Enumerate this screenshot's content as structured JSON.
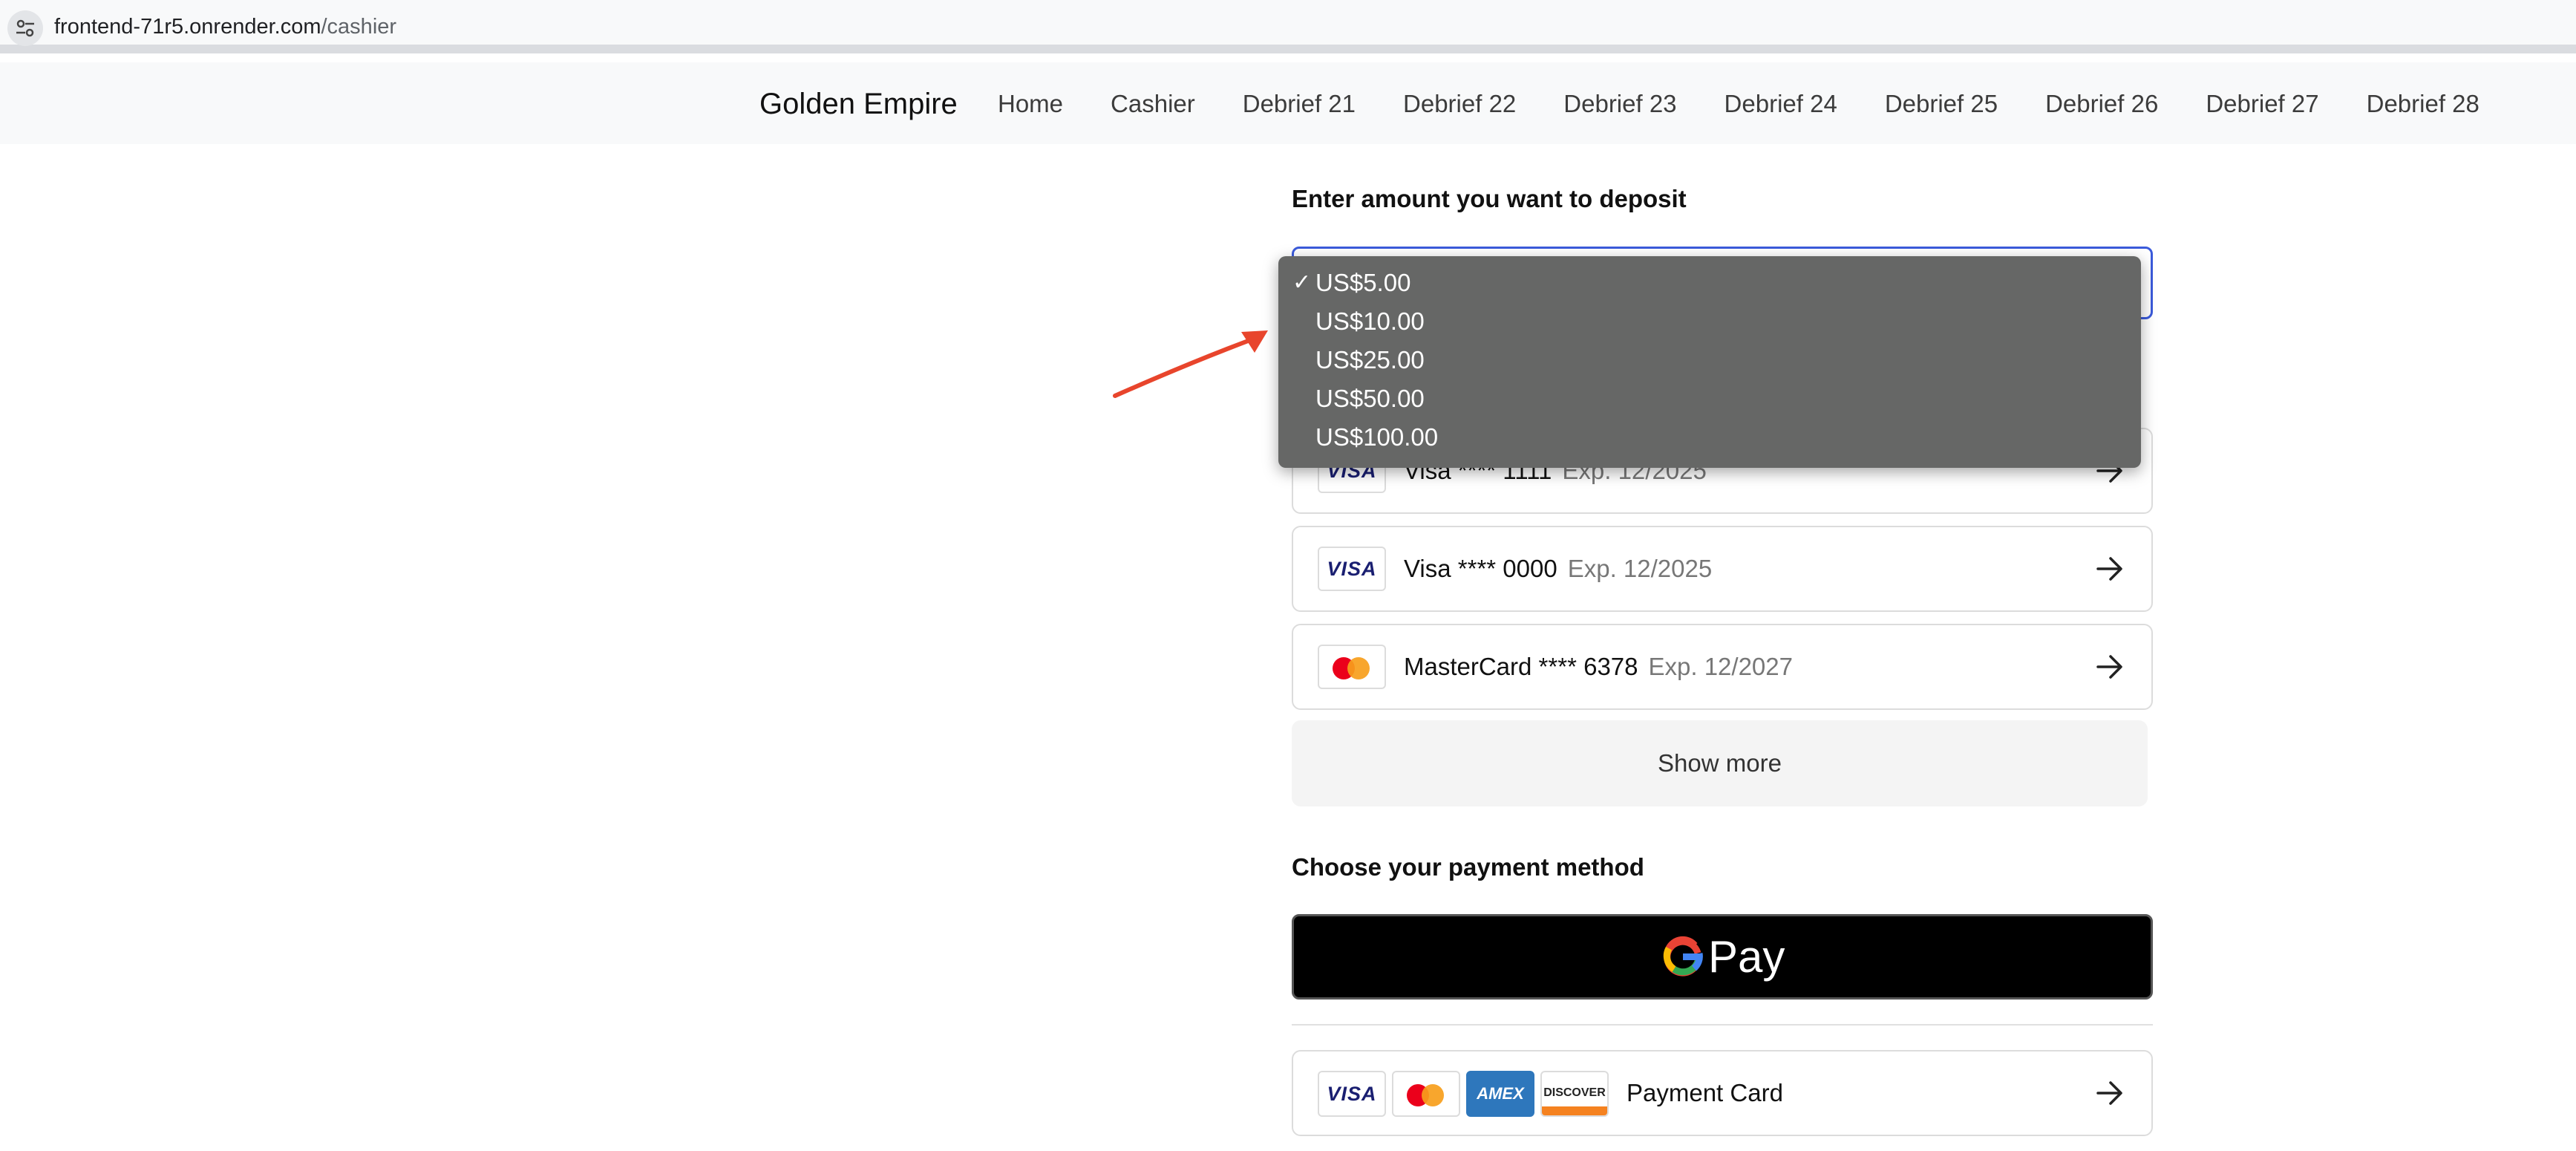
{
  "browser": {
    "url_host": "frontend-71r5.onrender.com",
    "url_path": "/cashier"
  },
  "nav": {
    "brand": "Golden Empire",
    "links": [
      "Home",
      "Cashier",
      "Debrief 21",
      "Debrief 22",
      "Debrief 23",
      "Debrief 24",
      "Debrief 25",
      "Debrief 26",
      "Debrief 27",
      "Debrief 28"
    ]
  },
  "deposit": {
    "label": "Enter amount you want to deposit",
    "selected": "US$5.00",
    "options": [
      "US$5.00",
      "US$10.00",
      "US$25.00",
      "US$50.00",
      "US$100.00"
    ],
    "check_mark": "✓"
  },
  "saved_cards": [
    {
      "brand": "VISA",
      "name": "Visa **** 1111",
      "exp": "Exp. 12/2025"
    },
    {
      "brand": "VISA",
      "name": "Visa **** 0000",
      "exp": "Exp. 12/2025"
    },
    {
      "brand": "mastercard",
      "name": "MasterCard **** 6378",
      "exp": "Exp. 12/2027"
    }
  ],
  "show_more_label": "Show more",
  "payment": {
    "label": "Choose your payment method",
    "gpay_label": "Pay",
    "card_option_label": "Payment Card",
    "logos": {
      "visa": "VISA",
      "amex": "AMEX",
      "discover": "DISCOVER"
    }
  },
  "colors": {
    "focus_border": "#3b5bdb",
    "dropdown_bg": "#666766",
    "annotation_arrow": "#e8452c"
  }
}
